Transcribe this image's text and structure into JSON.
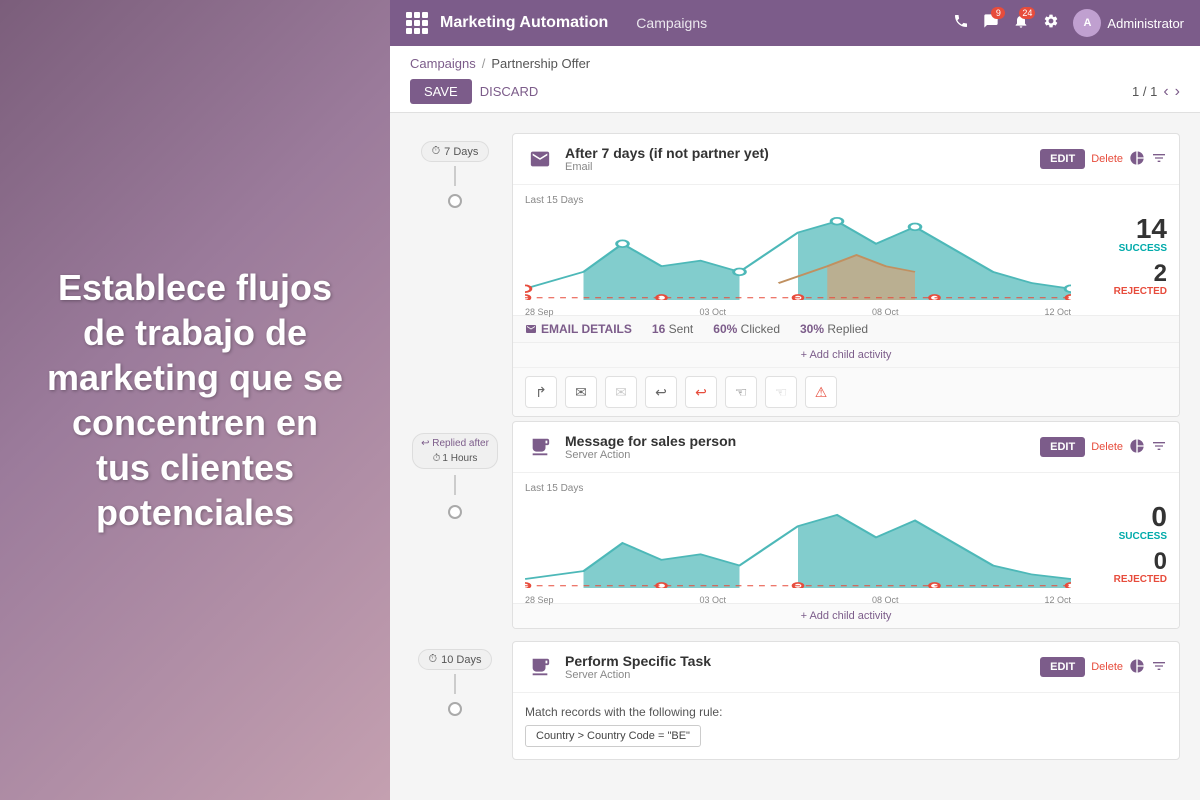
{
  "left_panel": {
    "text": "Establece flujos de trabajo de marketing que se concentren en tus clientes potenciales"
  },
  "topbar": {
    "title": "Marketing Automation",
    "nav_item": "Campaigns",
    "admin_label": "Administrator",
    "badge1": "9",
    "badge2": "24"
  },
  "breadcrumb": {
    "link": "Campaigns",
    "separator": "/",
    "current": "Partnership Offer"
  },
  "actions": {
    "save": "SAVE",
    "discard": "DISCARD",
    "pagination": "1 / 1"
  },
  "card1": {
    "trigger": "7 Days",
    "title": "After 7 days (if not partner yet)",
    "subtitle": "Email",
    "edit": "EDIT",
    "delete": "Delete",
    "chart_label": "Last 15 Days",
    "x_labels": [
      "28 Sep",
      "03 Oct",
      "08 Oct",
      "12 Oct"
    ],
    "success_num": "14",
    "success_label": "SUCCESS",
    "rejected_num": "2",
    "rejected_label": "REJECTED",
    "email_details_label": "EMAIL DETAILS",
    "sent": "16 Sent",
    "clicked": "60% Clicked",
    "replied": "30% Replied",
    "add_child": "+ Add child activity",
    "actions": [
      "↱",
      "✉",
      "✉",
      "↩",
      "↩",
      "☜",
      "☜",
      "⚠"
    ]
  },
  "card2": {
    "replied_line1": "↩ Replied after",
    "replied_line2": "1 Hours",
    "title": "Message for sales person",
    "subtitle": "Server Action",
    "edit": "EDIT",
    "delete": "Delete",
    "chart_label": "Last 15 Days",
    "x_labels": [
      "28 Sep",
      "03 Oct",
      "08 Oct",
      "12 Oct"
    ],
    "success_num": "0",
    "success_label": "SUCCESS",
    "rejected_num": "0",
    "rejected_label": "REJECTED",
    "add_child": "+ Add child activity"
  },
  "card3": {
    "trigger": "10 Days",
    "title": "Perform Specific Task",
    "subtitle": "Server Action",
    "edit": "EDIT",
    "delete": "Delete",
    "rule_desc": "Match records with the following rule:",
    "rule_value": "Country > Country Code = \"BE\""
  },
  "colors": {
    "primary": "#7c5c8a",
    "teal": "#00aaaa",
    "red": "#e74c3c",
    "chart_teal": "#4db8b8",
    "chart_brown": "#c8a882"
  }
}
